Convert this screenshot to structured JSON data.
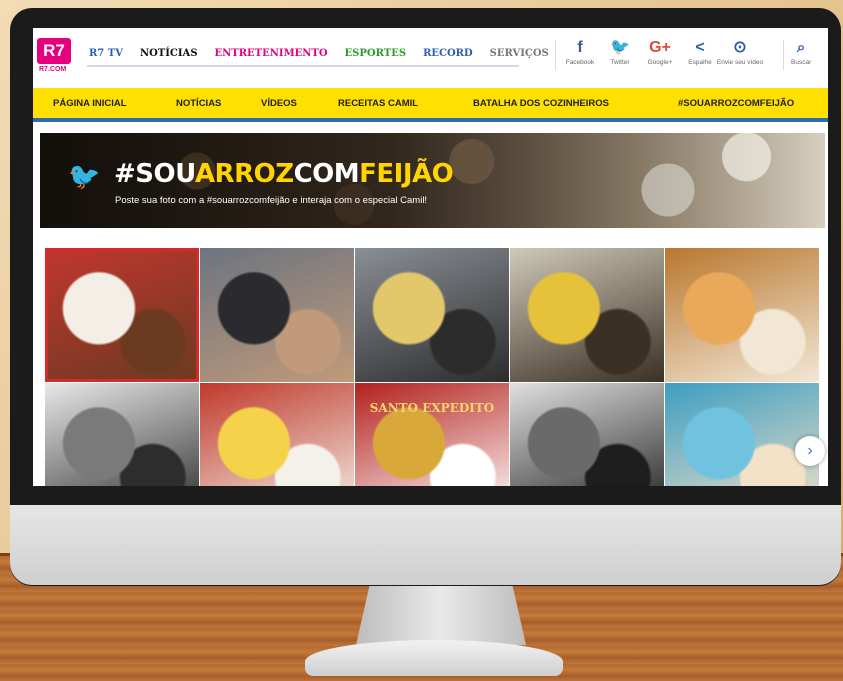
{
  "logo": {
    "mark": "R7",
    "sub": "R7.COM"
  },
  "nav": [
    {
      "label": "R7 TV",
      "color": "#2a5db0"
    },
    {
      "label": "NOTÍCIAS",
      "color": "#111111"
    },
    {
      "label": "ENTRETENIMENTO",
      "color": "#e5007e"
    },
    {
      "label": "ESPORTES",
      "color": "#2e9a2e"
    },
    {
      "label": "RECORD",
      "color": "#2a5db0"
    },
    {
      "label": "SERVIÇOS",
      "color": "#777777"
    }
  ],
  "social": [
    {
      "icon": "facebook-icon",
      "glyph": "f",
      "label": "Facebook",
      "color": "#3b5998"
    },
    {
      "icon": "twitter-icon",
      "glyph": "🐦",
      "label": "Twitter",
      "color": "#1da1f2"
    },
    {
      "icon": "google-plus-icon",
      "glyph": "G+",
      "label": "Google+",
      "color": "#dd4b39"
    },
    {
      "icon": "share-icon",
      "glyph": "<",
      "label": "Espalhe",
      "color": "#2a5db0"
    },
    {
      "icon": "upload-icon",
      "glyph": "⊙",
      "label": "Envie seu vídeo",
      "color": "#2a5db0"
    }
  ],
  "search": {
    "glyph": "⌕",
    "label": "Buscar"
  },
  "yellow_nav": [
    "PÁGINA INICIAL",
    "NOTÍCIAS",
    "VÍDEOS",
    "RECEITAS CAMIL",
    "BATALHA DOS COZINHEIROS",
    "#SOUARROZCOMFEIJÃO"
  ],
  "banner": {
    "hashtag_white_1": "#SOU",
    "hashtag_yellow_1": "ARROZ",
    "hashtag_white_2": "COM",
    "hashtag_yellow_2": "FEIJÃO",
    "subtitle": "Poste sua foto com a  #souarrozcomfeijão e interaja com o especial Camil!"
  },
  "photos": [
    {
      "name": "photo-plate-eggs",
      "colors": [
        "#c2362f",
        "#f4efe6",
        "#6b3a20"
      ]
    },
    {
      "name": "photo-bearded-man",
      "colors": [
        "#6d7480",
        "#2b2a2f",
        "#c09a7a"
      ]
    },
    {
      "name": "photo-kitchen-pots",
      "colors": [
        "#8a8f96",
        "#e2c86a",
        "#2c2c2c"
      ]
    },
    {
      "name": "photo-woman-sunglasses",
      "colors": [
        "#cfc9b8",
        "#e6c23a",
        "#3a3024"
      ]
    },
    {
      "name": "photo-chickpeas-bowl",
      "colors": [
        "#b9772e",
        "#e9a85a",
        "#f2e7d5"
      ]
    },
    {
      "name": "photo-smiling-woman",
      "colors": [
        "#e8e8e8",
        "#7a7a7a",
        "#2d2d2d"
      ]
    },
    {
      "name": "photo-plates-rice",
      "colors": [
        "#c0392b",
        "#f6d24a",
        "#f4f1ea"
      ]
    },
    {
      "name": "photo-santo-expedito",
      "colors": [
        "#b3201c",
        "#d8a93a",
        "#ffffff"
      ],
      "text": "SANTO EXPEDITO"
    },
    {
      "name": "photo-man-child",
      "colors": [
        "#e0e0e0",
        "#6a6a6a",
        "#1e1e1e"
      ]
    },
    {
      "name": "photo-saint-card",
      "colors": [
        "#3c9ec2",
        "#6fc3df",
        "#f3e1c8"
      ]
    }
  ],
  "next_arrow": "›"
}
